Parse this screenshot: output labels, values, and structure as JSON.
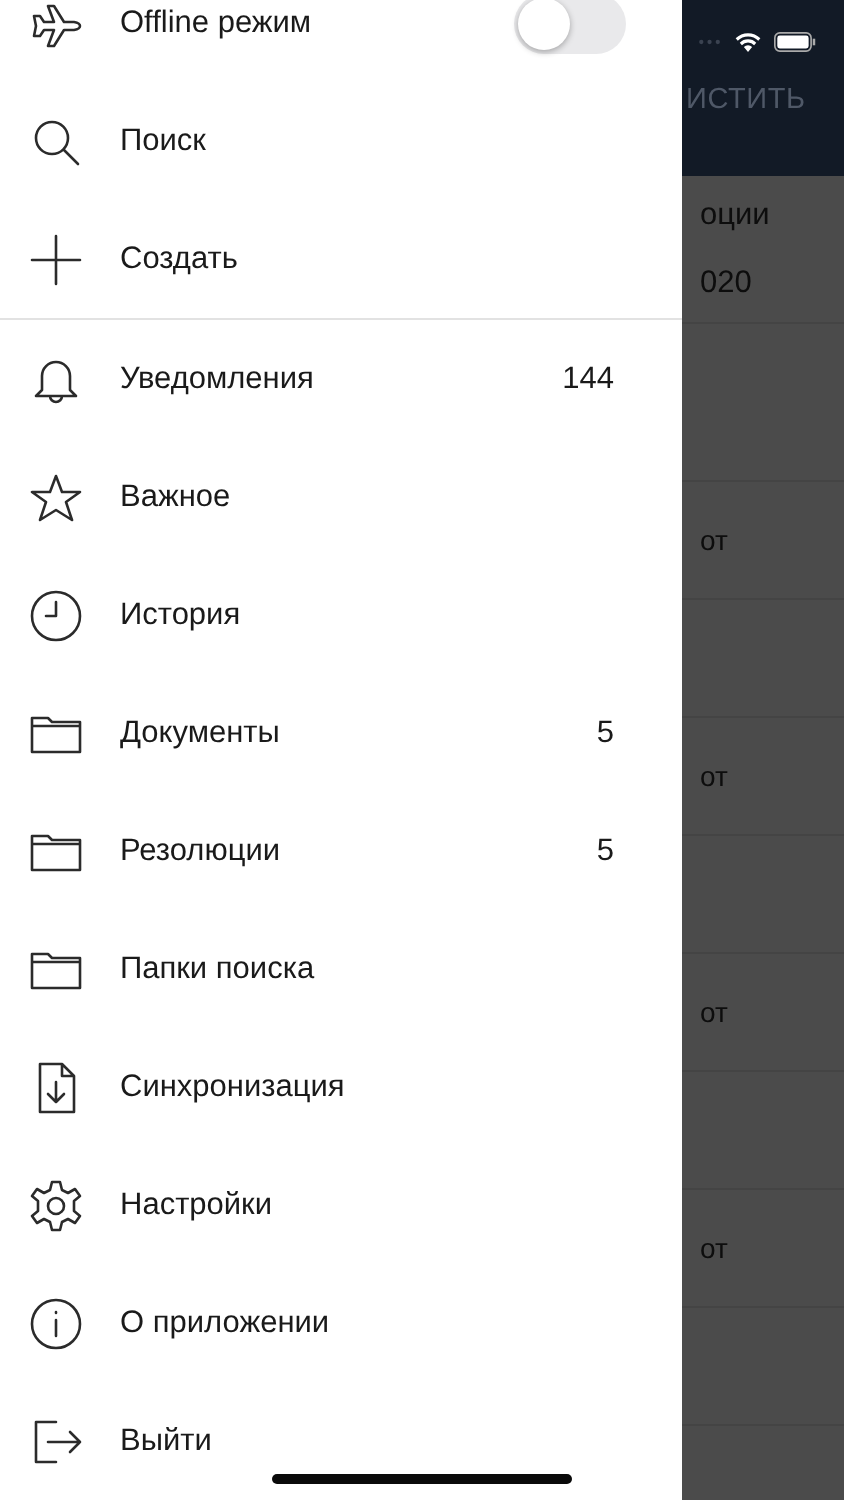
{
  "menu": {
    "sections": [
      [
        {
          "label": "Offline режим",
          "kind": "toggle",
          "on": false
        },
        {
          "label": "Поиск",
          "kind": "link"
        },
        {
          "label": "Создать",
          "kind": "link"
        }
      ],
      [
        {
          "label": "Уведомления",
          "kind": "link",
          "count": "144"
        },
        {
          "label": "Важное",
          "kind": "link"
        },
        {
          "label": "История",
          "kind": "link"
        },
        {
          "label": "Документы",
          "kind": "link",
          "count": "5"
        },
        {
          "label": "Резолюции",
          "kind": "link",
          "count": "5"
        },
        {
          "label": "Папки поиска",
          "kind": "link"
        },
        {
          "label": "Синхронизация",
          "kind": "link"
        },
        {
          "label": "Настройки",
          "kind": "link"
        },
        {
          "label": "О приложении",
          "kind": "link"
        },
        {
          "label": "Выйти",
          "kind": "link"
        }
      ]
    ]
  },
  "background_screen": {
    "header_action": "ИСТИТЬ",
    "title_lines": [
      "оции",
      "020"
    ],
    "rows": [
      {
        "text": "от"
      },
      {
        "text": "от"
      },
      {
        "text": "от"
      },
      {
        "text": "от"
      }
    ]
  }
}
